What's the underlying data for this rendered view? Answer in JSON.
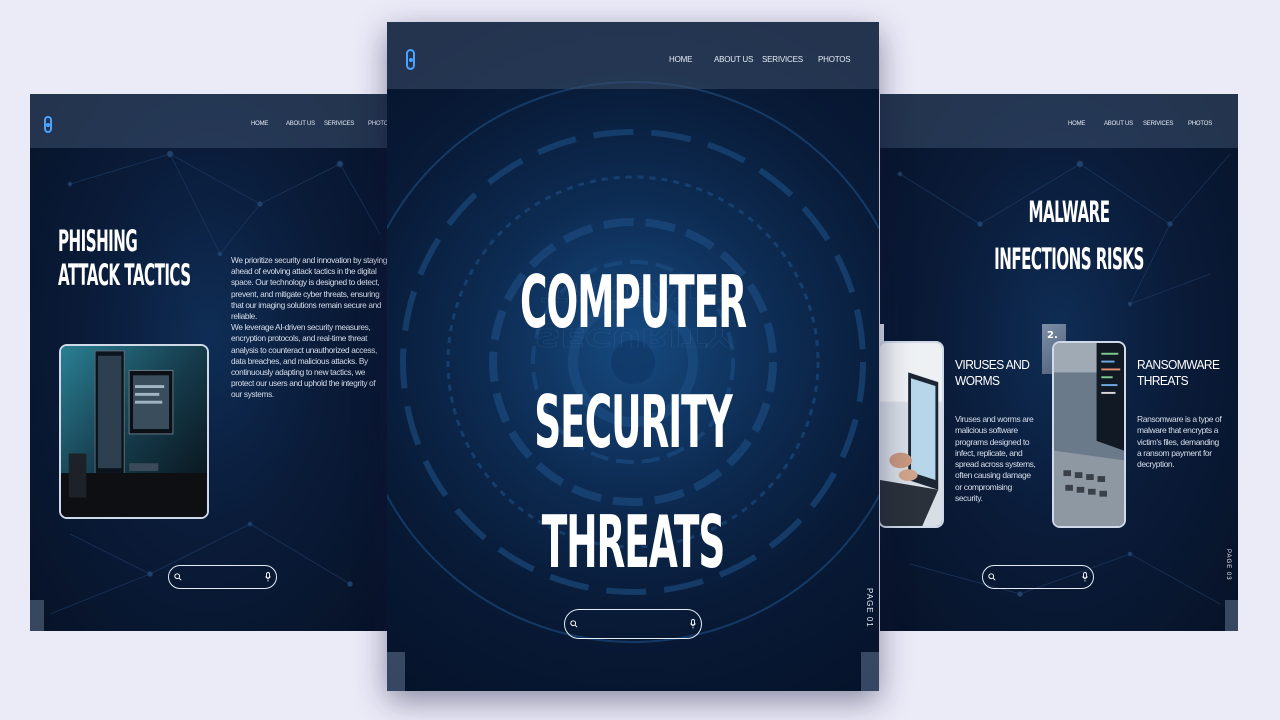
{
  "nav": {
    "home": "HOME",
    "about": "ABOUT US",
    "services": "SERIVICES",
    "photos": "PHOTOS"
  },
  "left_slide": {
    "title_line1": "PHISHING",
    "title_line2": "ATTACK TACTICS",
    "paragraph1": "We prioritize security and innovation by staying ahead of evolving attack tactics in the digital space. Our technology is designed to detect, prevent, and mitigate cyber threats, ensuring that our imaging solutions remain secure and reliable.",
    "paragraph2": "We leverage AI-driven security measures, encryption protocols, and real-time threat analysis to counteract unauthorized access, data breaches, and malicious attacks. By continuously adapting to new tactics, we protect our users and uphold the integrity of our systems."
  },
  "center_slide": {
    "title_line1": "COMPUTER",
    "title_line2": "SECURITY THREATS",
    "page_label": "PAGE 01"
  },
  "right_slide": {
    "title_line1": "MALWARE",
    "title_line2": "INFECTIONS RISKS",
    "card1": {
      "title_line1": "VIRUSES AND",
      "title_line2": "WORMS",
      "body": "Viruses and worms are malicious software programs designed to infect, replicate, and spread across systems, often causing damage or compromising security."
    },
    "card2": {
      "number": "2.",
      "title_line1": "RANSOMWARE",
      "title_line2": "THREATS",
      "body": "Ransomware is a type of malware that encrypts a victim's files, demanding a ransom payment for decryption."
    },
    "page_label": "PAGE 03"
  },
  "colors": {
    "accent": "#4aa3ff",
    "slide_bg": "#0a1c3a",
    "page_bg": "#ebebf8"
  },
  "icons": {
    "logo": "lock-shield-icon",
    "search": "search-icon",
    "mic": "microphone-icon"
  }
}
